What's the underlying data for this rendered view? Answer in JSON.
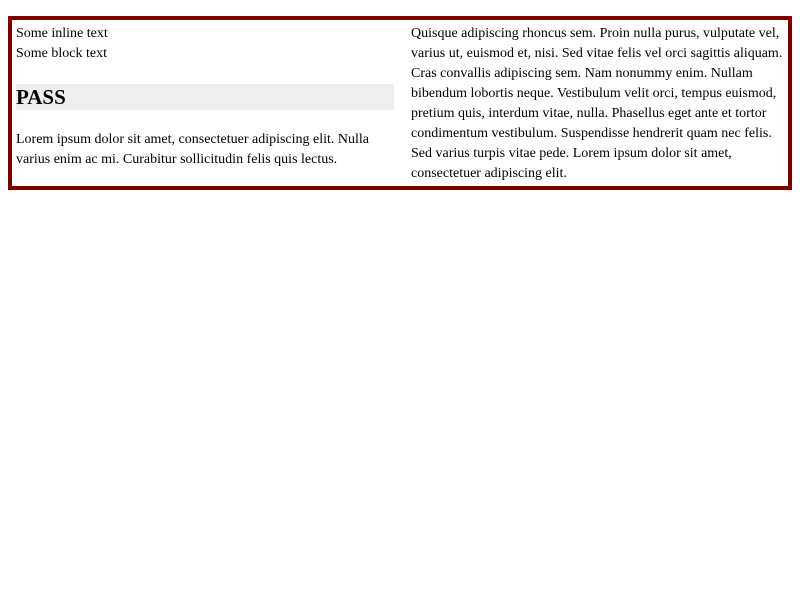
{
  "left": {
    "inline_text": "Some inline text",
    "block_text": "Some block text",
    "result_label": "PASS",
    "paragraph": "Lorem ipsum dolor sit amet, consectetuer adipiscing elit. Nulla varius enim ac mi. Curabitur sollicitudin felis quis lectus."
  },
  "right": {
    "paragraph": "Quisque adipiscing rhoncus sem. Proin nulla purus, vulputate vel, varius ut, euismod et, nisi. Sed vitae felis vel orci sagittis aliquam. Cras convallis adipiscing sem. Nam nonummy enim. Nullam bibendum lobortis neque. Vestibulum velit orci, tempus euismod, pretium quis, interdum vitae, nulla. Phasellus eget ante et tortor condimentum vestibulum. Suspendisse hendrerit quam nec felis. Sed varius turpis vitae pede. Lorem ipsum dolor sit amet, consectetuer adipiscing elit."
  },
  "colors": {
    "border": "#800000",
    "pass_background": "#eeeeee",
    "text": "#000000"
  }
}
